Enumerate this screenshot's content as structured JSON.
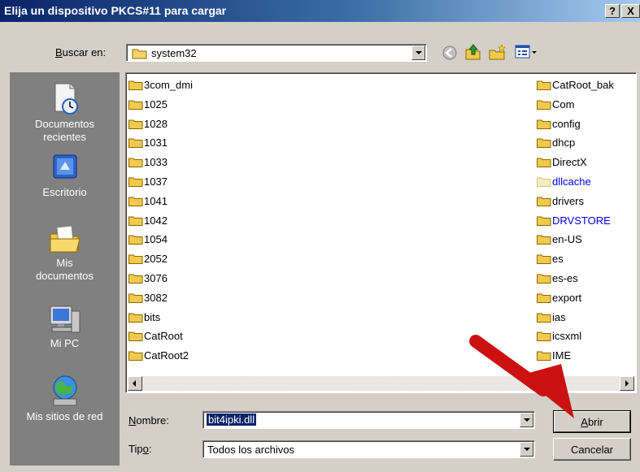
{
  "window": {
    "title": "Elija un dispositivo PKCS#11 para cargar",
    "help_label": "?",
    "close_label": "X"
  },
  "lookin": {
    "label_prefix": "",
    "label_u": "B",
    "label_rest": "uscar en:",
    "value": "system32"
  },
  "toolbar": {
    "icons": [
      "back-icon",
      "up-folder-icon",
      "new-folder-icon",
      "view-menu-icon"
    ]
  },
  "places": [
    {
      "label_line1": "Documentos",
      "label_line2": "recientes",
      "icon": "recent-documents-icon"
    },
    {
      "label_line1": "Escritorio",
      "label_line2": "",
      "icon": "desktop-icon"
    },
    {
      "label_line1": "Mis",
      "label_line2": "documentos",
      "icon": "my-documents-icon"
    },
    {
      "label_line1": "Mi PC",
      "label_line2": "",
      "icon": "my-computer-icon"
    },
    {
      "label_line1": "Mis sitios de red",
      "label_line2": "",
      "icon": "network-places-icon"
    }
  ],
  "files_left": [
    {
      "name": "3com_dmi"
    },
    {
      "name": "1025"
    },
    {
      "name": "1028"
    },
    {
      "name": "1031"
    },
    {
      "name": "1033"
    },
    {
      "name": "1037"
    },
    {
      "name": "1041"
    },
    {
      "name": "1042"
    },
    {
      "name": "1054"
    },
    {
      "name": "2052"
    },
    {
      "name": "3076"
    },
    {
      "name": "3082"
    },
    {
      "name": "bits"
    },
    {
      "name": "CatRoot"
    },
    {
      "name": "CatRoot2"
    }
  ],
  "files_right": [
    {
      "name": "CatRoot_bak"
    },
    {
      "name": "Com"
    },
    {
      "name": "config"
    },
    {
      "name": "dhcp"
    },
    {
      "name": "DirectX"
    },
    {
      "name": "dllcache"
    },
    {
      "name": "drivers"
    },
    {
      "name": "DRVSTORE"
    },
    {
      "name": "en-US"
    },
    {
      "name": "es"
    },
    {
      "name": "es-es"
    },
    {
      "name": "export"
    },
    {
      "name": "ias"
    },
    {
      "name": "icsxml"
    },
    {
      "name": "IME"
    }
  ],
  "filename": {
    "label_u": "N",
    "label_rest": "ombre:",
    "value": "bit4ipki.dll"
  },
  "filetype": {
    "label_prefix": "Tip",
    "label_u": "o",
    "label_rest": ":",
    "value": "Todos los archivos"
  },
  "buttons": {
    "open_u": "A",
    "open_rest": "brir",
    "cancel": "Cancelar"
  },
  "colors": {
    "title_start": "#0a246a",
    "title_end": "#a6caf0",
    "dialog_bg": "#d4d0c8",
    "places_bg": "#808080",
    "link_blue": "#0000ff",
    "selection": "#0a246a",
    "annotation_arrow": "#cc1111"
  }
}
